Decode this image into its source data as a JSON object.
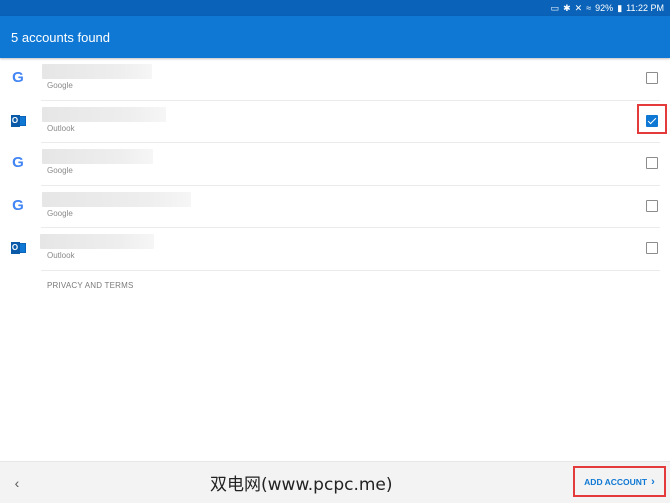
{
  "status_bar": {
    "battery": "92%",
    "time": "11:22 PM",
    "icons": [
      "cast-icon",
      "bluetooth-icon",
      "mute-icon",
      "wifi-icon",
      "battery-icon"
    ]
  },
  "header": {
    "title": "5 accounts found"
  },
  "accounts": [
    {
      "provider": "Google",
      "icon": "google-icon",
      "checked": false
    },
    {
      "provider": "Outlook",
      "icon": "outlook-icon",
      "checked": true
    },
    {
      "provider": "Google",
      "icon": "google-icon",
      "checked": false
    },
    {
      "provider": "Google",
      "icon": "google-icon",
      "checked": false
    },
    {
      "provider": "Outlook",
      "icon": "outlook-icon",
      "checked": false
    }
  ],
  "privacy_link": "PRIVACY AND TERMS",
  "footer": {
    "watermark": "双电网(www.pcpc.me)",
    "add_account_label": "ADD ACCOUNT"
  },
  "colors": {
    "accent": "#0f78d4",
    "status_bar": "#0a63b9",
    "highlight": "#e33b3b"
  }
}
